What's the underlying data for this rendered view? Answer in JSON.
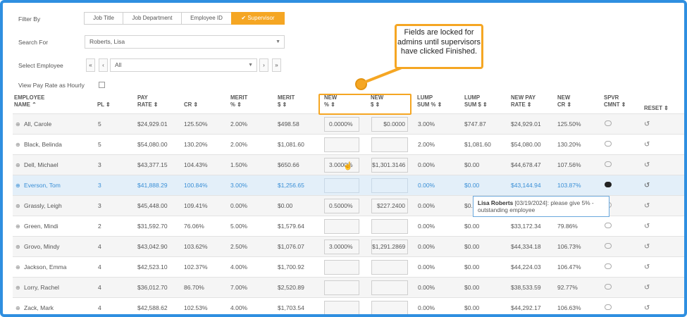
{
  "filter": {
    "label": "Filter By",
    "options": [
      "Job Title",
      "Job Department",
      "Employee ID",
      "Supervisor"
    ],
    "active": "✔ Supervisor"
  },
  "search": {
    "label": "Search For",
    "value": "Roberts, Lisa"
  },
  "select_employee": {
    "label": "Select Employee",
    "value": "All",
    "nav": [
      "«",
      "‹",
      "›",
      "»"
    ]
  },
  "view_hourly": {
    "label": "View Pay Rate as Hourly"
  },
  "columns": {
    "name": [
      "EMPLOYEE",
      "NAME ⌃"
    ],
    "pl": [
      "PL ⇕"
    ],
    "pay": [
      "PAY",
      "RATE ⇕"
    ],
    "cr": [
      "CR ⇕"
    ],
    "merit_pct": [
      "MERIT",
      "% ⇕"
    ],
    "merit_dol": [
      "MERIT",
      "$ ⇕"
    ],
    "new_pct": [
      "NEW",
      "% ⇕"
    ],
    "new_dol": [
      "NEW",
      "$ ⇕"
    ],
    "lump_pct": [
      "LUMP",
      "SUM % ⇕"
    ],
    "lump_dol": [
      "LUMP",
      "SUM $ ⇕"
    ],
    "new_pay": [
      "NEW PAY",
      "RATE ⇕"
    ],
    "new_cr": [
      "NEW",
      "CR ⇕"
    ],
    "spvr": [
      "SPVR",
      "CMNT ⇕"
    ],
    "reset": [
      "RESET ⇕"
    ]
  },
  "rows": [
    {
      "name": "All, Carole",
      "pl": "5",
      "pay": "$24,929.01",
      "cr": "125.50%",
      "merit_pct": "2.00%",
      "merit_dol": "$498.58",
      "new_pct": "0.0000%",
      "new_dol": "$0.0000",
      "lump_pct": "3.00%",
      "lump_dol": "$747.87",
      "new_pay": "$24,929.01",
      "new_cr": "125.50%"
    },
    {
      "name": "Black, Belinda",
      "pl": "5",
      "pay": "$54,080.00",
      "cr": "130.20%",
      "merit_pct": "2.00%",
      "merit_dol": "$1,081.60",
      "new_pct": "",
      "new_dol": "",
      "lump_pct": "2.00%",
      "lump_dol": "$1,081.60",
      "new_pay": "$54,080.00",
      "new_cr": "130.20%"
    },
    {
      "name": "Dell, Michael",
      "pl": "3",
      "pay": "$43,377.15",
      "cr": "104.43%",
      "merit_pct": "1.50%",
      "merit_dol": "$650.66",
      "new_pct": "3.0000%",
      "new_dol": "$1,301.3146",
      "lump_pct": "0.00%",
      "lump_dol": "$0.00",
      "new_pay": "$44,678.47",
      "new_cr": "107.56%"
    },
    {
      "name": "Everson, Tom",
      "pl": "3",
      "pay": "$41,888.29",
      "cr": "100.84%",
      "merit_pct": "3.00%",
      "merit_dol": "$1,256.65",
      "new_pct": "",
      "new_dol": "",
      "lump_pct": "0.00%",
      "lump_dol": "$0.00",
      "new_pay": "$43,144.94",
      "new_cr": "103.87%"
    },
    {
      "name": "Grassly, Leigh",
      "pl": "3",
      "pay": "$45,448.00",
      "cr": "109.41%",
      "merit_pct": "0.00%",
      "merit_dol": "$0.00",
      "new_pct": "0.5000%",
      "new_dol": "$227.2400",
      "lump_pct": "0.00%",
      "lump_dol": "$0.",
      "new_pay": "",
      "new_cr": ""
    },
    {
      "name": "Green, Mindi",
      "pl": "2",
      "pay": "$31,592.70",
      "cr": "76.06%",
      "merit_pct": "5.00%",
      "merit_dol": "$1,579.64",
      "new_pct": "",
      "new_dol": "",
      "lump_pct": "0.00%",
      "lump_dol": "$0.00",
      "new_pay": "$33,172.34",
      "new_cr": "79.86%"
    },
    {
      "name": "Grovo, Mindy",
      "pl": "4",
      "pay": "$43,042.90",
      "cr": "103.62%",
      "merit_pct": "2.50%",
      "merit_dol": "$1,076.07",
      "new_pct": "3.0000%",
      "new_dol": "$1,291.2869",
      "lump_pct": "0.00%",
      "lump_dol": "$0.00",
      "new_pay": "$44,334.18",
      "new_cr": "106.73%"
    },
    {
      "name": "Jackson, Emma",
      "pl": "4",
      "pay": "$42,523.10",
      "cr": "102.37%",
      "merit_pct": "4.00%",
      "merit_dol": "$1,700.92",
      "new_pct": "",
      "new_dol": "",
      "lump_pct": "0.00%",
      "lump_dol": "$0.00",
      "new_pay": "$44,224.03",
      "new_cr": "106.47%"
    },
    {
      "name": "Lorry, Rachel",
      "pl": "4",
      "pay": "$36,012.70",
      "cr": "86.70%",
      "merit_pct": "7.00%",
      "merit_dol": "$2,520.89",
      "new_pct": "",
      "new_dol": "",
      "lump_pct": "0.00%",
      "lump_dol": "$0.00",
      "new_pay": "$38,533.59",
      "new_cr": "92.77%"
    },
    {
      "name": "Zack, Mark",
      "pl": "4",
      "pay": "$42,588.62",
      "cr": "102.53%",
      "merit_pct": "4.00%",
      "merit_dol": "$1,703.54",
      "new_pct": "",
      "new_dol": "",
      "lump_pct": "0.00%",
      "lump_dol": "$0.00",
      "new_pay": "$44,292.17",
      "new_cr": "106.63%"
    }
  ],
  "callout": "Fields are locked for admins until supervisors have clicked Finished.",
  "tooltip": {
    "author": "Lisa Roberts",
    "text": "[03/19/2024]: please give 5% - outstanding employee"
  },
  "colors": {
    "accent": "#f5a623",
    "frame": "#2f8fe0",
    "selected_row": "#e3eff9",
    "link": "#3a8fd6"
  }
}
